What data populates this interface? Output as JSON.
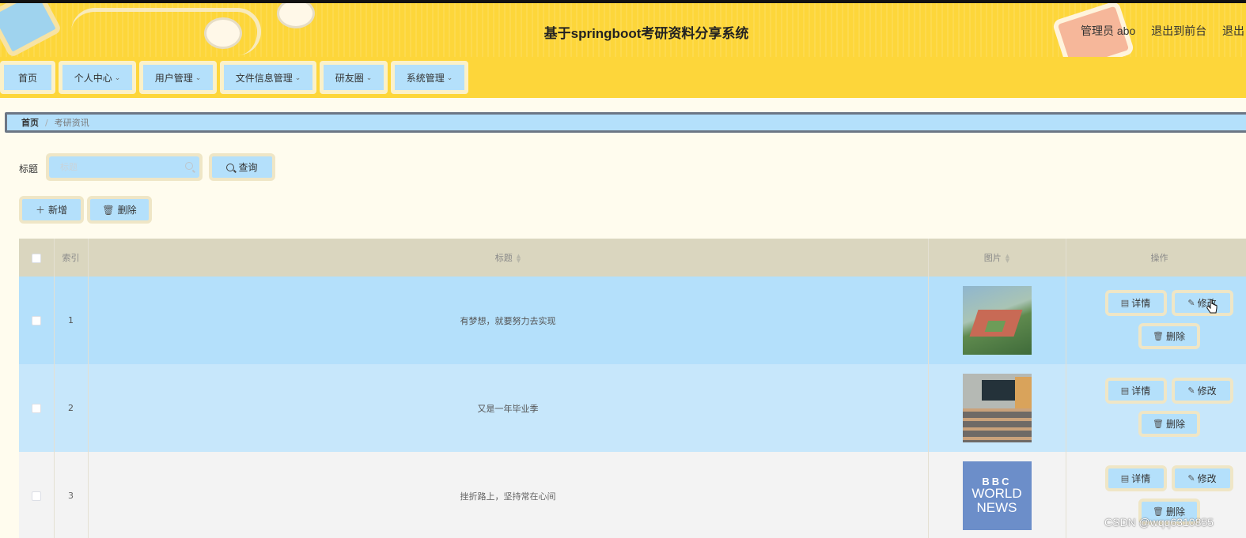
{
  "header": {
    "title": "基于springboot考研资料分享系统",
    "admin_text": "管理员 abo",
    "to_front": "退出到前台",
    "logout": "退出"
  },
  "nav": {
    "items": [
      {
        "label": "首页"
      },
      {
        "label": "个人中心"
      },
      {
        "label": "用户管理"
      },
      {
        "label": "文件信息管理"
      },
      {
        "label": "研友圈"
      },
      {
        "label": "系统管理"
      }
    ]
  },
  "breadcrumb": {
    "home": "首页",
    "sep": "/",
    "current": "考研资讯"
  },
  "search": {
    "label": "标题",
    "placeholder": "标题",
    "value": "",
    "button": "查询"
  },
  "actions": {
    "add": "新增",
    "delete": "删除"
  },
  "table": {
    "columns": {
      "index": "索引",
      "title": "标题",
      "image": "图片",
      "ops": "操作"
    },
    "rows": [
      {
        "index": "1",
        "title": "有梦想，就要努力去实现"
      },
      {
        "index": "2",
        "title": "又是一年毕业季"
      },
      {
        "index": "3",
        "title": "挫折路上，坚持常在心间"
      }
    ],
    "row_actions": {
      "detail": "详情",
      "edit": "修改",
      "delete": "删除"
    },
    "thumb3": {
      "line1": "BBC",
      "line2": "WORLD",
      "line3": "NEWS"
    }
  },
  "watermark": "CSDN @wqq6310855",
  "colors": {
    "header_bg": "#fdd63a",
    "accent_blue": "#b4e0fb",
    "page_bg": "#fffcee",
    "table_header": "#dad6bf"
  }
}
